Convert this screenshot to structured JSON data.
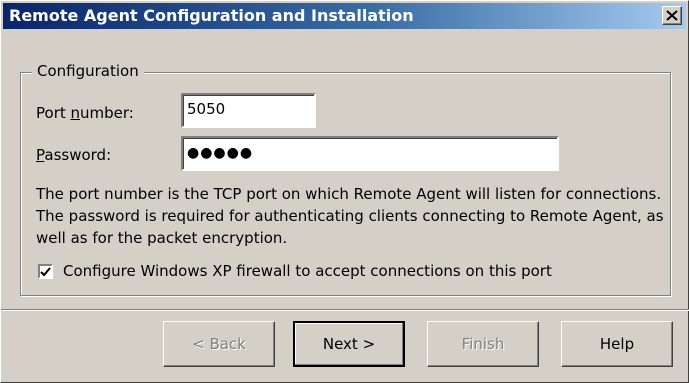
{
  "window": {
    "title": "Remote Agent Configuration and Installation",
    "close_label": "X"
  },
  "configuration": {
    "group_label": "Configuration",
    "port_label_pre": "Port ",
    "port_label_accel": "n",
    "port_label_post": "umber:",
    "port_value": "5050",
    "password_label_accel": "P",
    "password_label_post": "assword:",
    "password_value": "●●●●●",
    "description": "The port number is the TCP port on which Remote Agent will listen for connections. The password is required for authenticating clients connecting to Remote Agent, as well as for the packet encryption.",
    "firewall_checked": true,
    "firewall_label": "Configure Windows XP firewall to accept connections on this port"
  },
  "buttons": {
    "back": "< Back",
    "next": "Next >",
    "finish": "Finish",
    "help": "Help"
  }
}
